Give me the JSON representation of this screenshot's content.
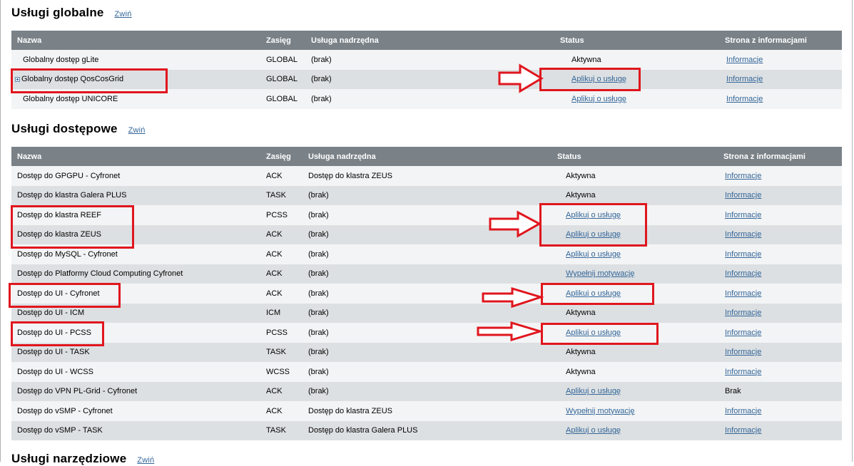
{
  "columns": {
    "name": "Nazwa",
    "scope": "Zasięg",
    "parent": "Usługa nadrzędna",
    "status": "Status",
    "info": "Strona z informacjami"
  },
  "global": {
    "title": "Usługi globalne",
    "toggle": "Zwiń",
    "rows": [
      {
        "name": "Globalny dostęp gLite",
        "scope": "GLOBAL",
        "parent": "(brak)",
        "status": "Aktywna",
        "status_link": false,
        "info": "Informacje",
        "info_link": true
      },
      {
        "name": "Globalny dostęp QosCosGrid",
        "scope": "GLOBAL",
        "parent": "(brak)",
        "status": "Aplikuj o usługę",
        "status_link": true,
        "info": "Informacje",
        "info_link": true,
        "expand_icon": "expand-plus-icon"
      },
      {
        "name": "Globalny dostęp UNICORE",
        "scope": "GLOBAL",
        "parent": "(brak)",
        "status": "Aplikuj o usługę",
        "status_link": true,
        "info": "Informacje",
        "info_link": true
      }
    ]
  },
  "access": {
    "title": "Usługi dostępowe",
    "toggle": "Zwiń",
    "rows": [
      {
        "name": "Dostęp do GPGPU - Cyfronet",
        "scope": "ACK",
        "parent": "Dostęp do klastra ZEUS",
        "status": "Aktywna",
        "status_link": false,
        "info": "Informacje",
        "info_link": true
      },
      {
        "name": "Dostęp do klastra Galera PLUS",
        "scope": "TASK",
        "parent": "(brak)",
        "status": "Aktywna",
        "status_link": false,
        "info": "Informacje",
        "info_link": true
      },
      {
        "name": "Dostęp do klastra REEF",
        "scope": "PCSS",
        "parent": "(brak)",
        "status": "Aplikuj o usługę",
        "status_link": true,
        "info": "Informacje",
        "info_link": true
      },
      {
        "name": "Dostęp do klastra ZEUS",
        "scope": "ACK",
        "parent": "(brak)",
        "status": "Aplikuj o usługę",
        "status_link": true,
        "info": "Informacje",
        "info_link": true
      },
      {
        "name": "Dostęp do MySQL - Cyfronet",
        "scope": "ACK",
        "parent": "(brak)",
        "status": "Aplikuj o usługę",
        "status_link": true,
        "info": "Informacje",
        "info_link": true
      },
      {
        "name": "Dostęp do Platformy Cloud Computing Cyfronet",
        "scope": "ACK",
        "parent": "(brak)",
        "status": "Wypełnij motywację",
        "status_link": true,
        "info": "Informacje",
        "info_link": true
      },
      {
        "name": "Dostęp do UI - Cyfronet",
        "scope": "ACK",
        "parent": "(brak)",
        "status": "Aplikuj o usługę",
        "status_link": true,
        "info": "Informacje",
        "info_link": true
      },
      {
        "name": "Dostęp do UI - ICM",
        "scope": "ICM",
        "parent": "(brak)",
        "status": "Aktywna",
        "status_link": false,
        "info": "Informacje",
        "info_link": true
      },
      {
        "name": "Dostęp do UI - PCSS",
        "scope": "PCSS",
        "parent": "(brak)",
        "status": "Aplikuj o usługę",
        "status_link": true,
        "info": "Informacje",
        "info_link": true
      },
      {
        "name": "Dostęp do UI - TASK",
        "scope": "TASK",
        "parent": "(brak)",
        "status": "Aktywna",
        "status_link": false,
        "info": "Informacje",
        "info_link": true
      },
      {
        "name": "Dostęp do UI - WCSS",
        "scope": "WCSS",
        "parent": "(brak)",
        "status": "Aktywna",
        "status_link": false,
        "info": "Informacje",
        "info_link": true
      },
      {
        "name": "Dostęp do VPN PL-Grid - Cyfronet",
        "scope": "ACK",
        "parent": "(brak)",
        "status": "Aplikuj o usługę",
        "status_link": true,
        "info": "Brak",
        "info_link": false
      },
      {
        "name": "Dostęp do vSMP - Cyfronet",
        "scope": "ACK",
        "parent": "Dostęp do klastra ZEUS",
        "status": "Wypełnij motywację",
        "status_link": true,
        "info": "Informacje",
        "info_link": true
      },
      {
        "name": "Dostęp do vSMP - TASK",
        "scope": "TASK",
        "parent": "Dostęp do klastra Galera PLUS",
        "status": "Aplikuj o usługę",
        "status_link": true,
        "info": "Informacje",
        "info_link": true
      }
    ]
  },
  "tools": {
    "title": "Usługi narzędziowe",
    "toggle": "Zwiń"
  },
  "colors": {
    "header_bg": "#7a8288",
    "row_light": "#f3f4f5",
    "row_dark": "#dde0e2",
    "link": "#336699",
    "annotation": "#e0161e"
  }
}
